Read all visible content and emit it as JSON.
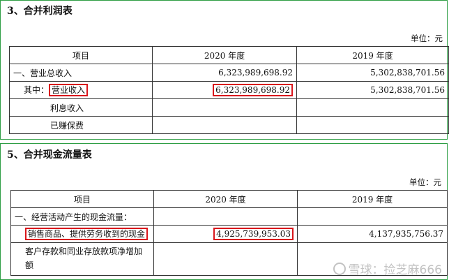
{
  "income_statement": {
    "title": "3、合并利润表",
    "unit": "单位：元",
    "headers": [
      "项目",
      "2020 年度",
      "2019 年度"
    ],
    "rows": [
      {
        "label": "一、营业总收入",
        "v2020": "6,323,989,698.92",
        "v2019": "5,302,838,701.56"
      },
      {
        "prefix": "其中：",
        "label": "营业收入",
        "v2020": "6,323,989,698.92",
        "v2019": "5,302,838,701.56"
      },
      {
        "label": "利息收入",
        "v2020": "",
        "v2019": ""
      },
      {
        "label": "已赚保费",
        "v2020": "",
        "v2019": ""
      }
    ]
  },
  "cash_flow_statement": {
    "title": "5、合并现金流量表",
    "unit": "单位：元",
    "headers": [
      "项目",
      "2020 年度",
      "2019 年度"
    ],
    "rows": [
      {
        "label": "一、经营活动产生的现金流量：",
        "v2020": "",
        "v2019": ""
      },
      {
        "label": "销售商品、提供劳务收到的现金",
        "v2020": "4,925,739,953.03",
        "v2019": "4,137,935,756.37"
      },
      {
        "label": "客户存款和同业存放款项净增加额",
        "v2020": "",
        "v2019": ""
      }
    ]
  },
  "watermark": {
    "text": "雪球：捡芝麻666",
    "icon": "snowball-logo-icon"
  },
  "colors": {
    "panel_border": "#2e9e44",
    "highlight": "#d9161c"
  }
}
